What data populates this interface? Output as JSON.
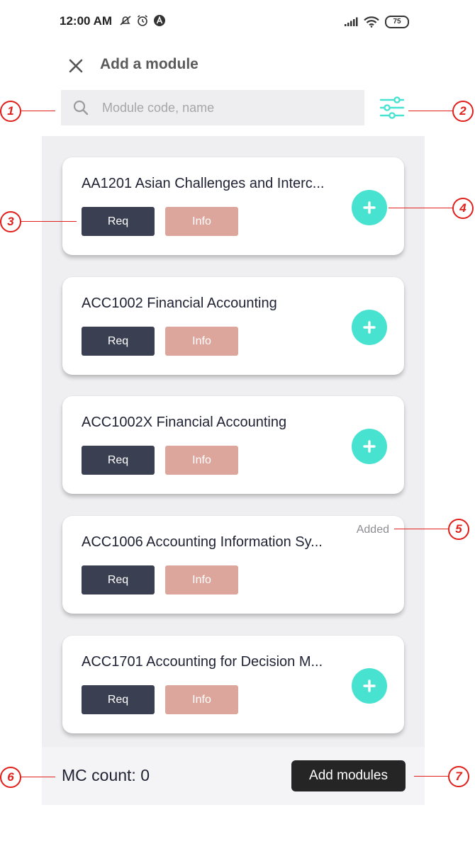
{
  "status_bar": {
    "time": "12:00 AM",
    "icons_left": [
      "notification-off-icon",
      "alarm-icon",
      "app-badge-icon"
    ],
    "icons_right": [
      "signal-icon",
      "wifi-icon"
    ],
    "battery": "75"
  },
  "header": {
    "title": "Add a module",
    "close_icon": "close-icon"
  },
  "search": {
    "placeholder": "Module code, name",
    "value": ""
  },
  "accent_color": "#48e2d1",
  "modules": [
    {
      "title": "AA1201 Asian Challenges and Interc...",
      "req_label": "Req",
      "info_label": "Info",
      "added": false
    },
    {
      "title": "ACC1002 Financial Accounting",
      "req_label": "Req",
      "info_label": "Info",
      "added": false
    },
    {
      "title": "ACC1002X Financial Accounting",
      "req_label": "Req",
      "info_label": "Info",
      "added": false
    },
    {
      "title": "ACC1006 Accounting Information Sy...",
      "req_label": "Req",
      "info_label": "Info",
      "added": true,
      "added_label": "Added"
    },
    {
      "title": "ACC1701 Accounting for Decision M...",
      "req_label": "Req",
      "info_label": "Info",
      "added": false
    }
  ],
  "footer": {
    "mc_count": "MC count: 0",
    "add_button": "Add modules"
  },
  "annotations": [
    "1",
    "2",
    "3",
    "4",
    "5",
    "6",
    "7"
  ]
}
